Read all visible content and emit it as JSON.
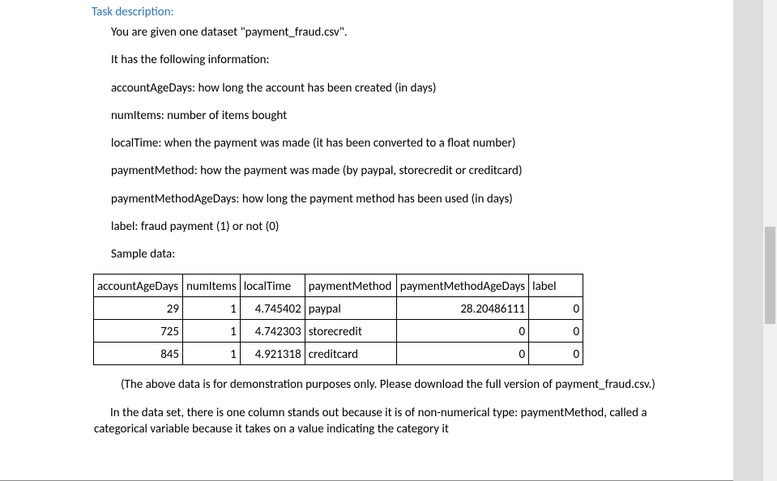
{
  "section_title": "Task description:",
  "paragraphs": {
    "intro": "You are given one dataset \"payment_fraud.csv\".",
    "has_info": "It has the following information:",
    "accountAgeDays": "accountAgeDays: how long the account has been created (in days)",
    "numItems": "numItems: number of items bought",
    "localTime": "localTime: when the payment was made (it has been converted to a float number)",
    "paymentMethod": "paymentMethod: how the payment was made (by paypal, storecredit or creditcard)",
    "paymentMethodAgeDays": "paymentMethodAgeDays: how long the payment method has been used (in days)",
    "label": "label: fraud payment (1) or not (0)",
    "sample_data": "Sample data:",
    "note": "(The above data is for demonstration purposes only. Please download the full version of payment_fraud.csv.)",
    "continuation": "In the data set, there is one column stands out because it is of non-numerical type: paymentMethod, called a categorical variable because it takes on a value indicating the category it"
  },
  "table": {
    "headers": [
      "accountAgeDays",
      "numItems",
      "localTime",
      "paymentMethod",
      "paymentMethodAgeDays",
      "label"
    ],
    "rows": [
      {
        "accountAgeDays": "29",
        "numItems": "1",
        "localTime": "4.745402",
        "paymentMethod": "paypal",
        "paymentMethodAgeDays": "28.20486111",
        "label": "0"
      },
      {
        "accountAgeDays": "725",
        "numItems": "1",
        "localTime": "4.742303",
        "paymentMethod": "storecredit",
        "paymentMethodAgeDays": "0",
        "label": "0"
      },
      {
        "accountAgeDays": "845",
        "numItems": "1",
        "localTime": "4.921318",
        "paymentMethod": "creditcard",
        "paymentMethodAgeDays": "0",
        "label": "0"
      }
    ]
  }
}
